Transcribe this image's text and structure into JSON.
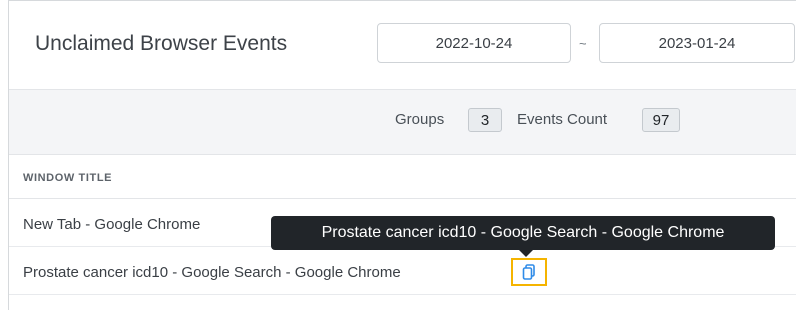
{
  "header": {
    "title": "Unclaimed Browser Events",
    "date_from": "2022-10-24",
    "date_separator": "~",
    "date_to": "2023-01-24"
  },
  "summary": {
    "groups_label": "Groups",
    "groups_count": "3",
    "events_label": "Events Count",
    "events_count": "97"
  },
  "table": {
    "column_header": "WINDOW TITLE",
    "rows": [
      {
        "title": "New Tab - Google Chrome"
      },
      {
        "title": "Prostate cancer icd10 - Google Search - Google Chrome"
      }
    ]
  },
  "tooltip": {
    "text": "Prostate cancer icd10 - Google Search - Google Chrome"
  },
  "icons": {
    "copy": "copy-icon"
  },
  "colors": {
    "accent_icon": "#2f8be8",
    "highlight": "#f5b400",
    "tooltip_bg": "#212529"
  }
}
